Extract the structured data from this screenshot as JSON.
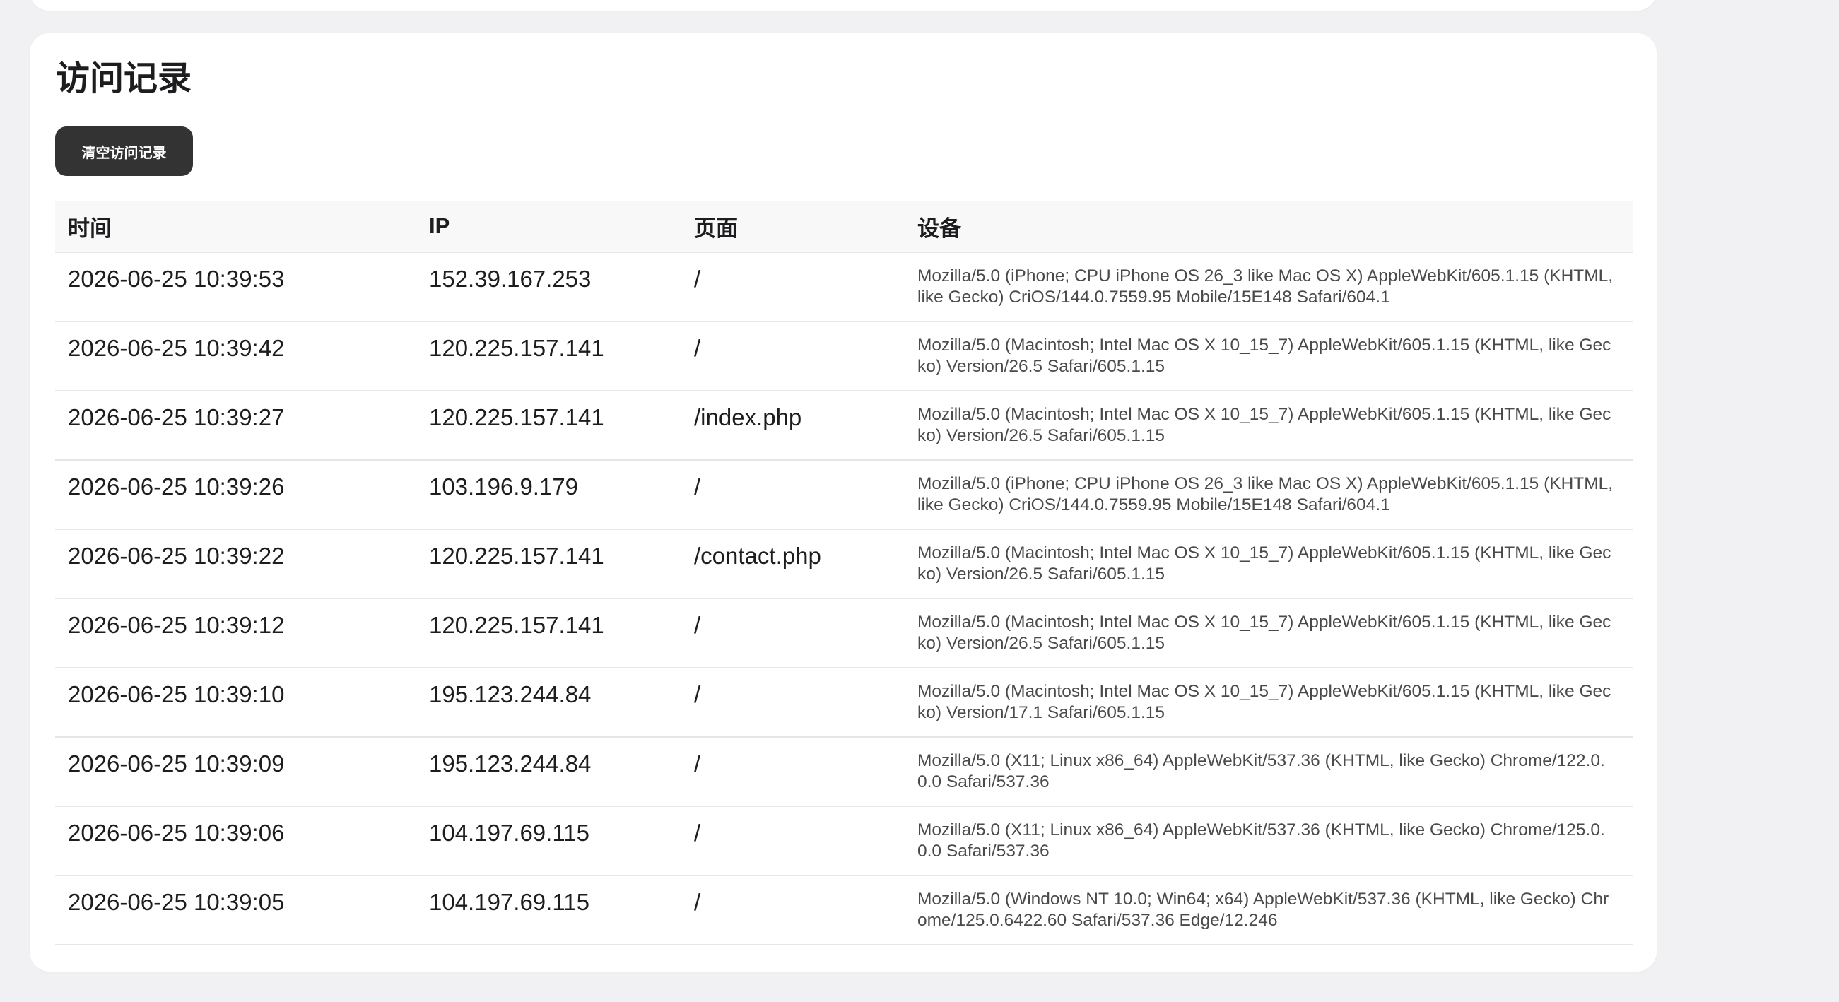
{
  "section": {
    "title": "访问记录",
    "clear_button": "清空访问记录"
  },
  "table": {
    "headers": {
      "time": "时间",
      "ip": "IP",
      "page": "页面",
      "device": "设备"
    },
    "rows": [
      {
        "time": "2026-06-25 10:39:53",
        "ip": "152.39.167.253",
        "page": "/",
        "device": "Mozilla/5.0 (iPhone; CPU iPhone OS 26_3 like Mac OS X) AppleWebKit/605.1.15 (KHTML, like Gecko) CriOS/144.0.7559.95 Mobile/15E148 Safari/604.1"
      },
      {
        "time": "2026-06-25 10:39:42",
        "ip": "120.225.157.141",
        "page": "/",
        "device": "Mozilla/5.0 (Macintosh; Intel Mac OS X 10_15_7) AppleWebKit/605.1.15 (KHTML, like Gecko) Version/26.5 Safari/605.1.15"
      },
      {
        "time": "2026-06-25 10:39:27",
        "ip": "120.225.157.141",
        "page": "/index.php",
        "device": "Mozilla/5.0 (Macintosh; Intel Mac OS X 10_15_7) AppleWebKit/605.1.15 (KHTML, like Gecko) Version/26.5 Safari/605.1.15"
      },
      {
        "time": "2026-06-25 10:39:26",
        "ip": "103.196.9.179",
        "page": "/",
        "device": "Mozilla/5.0 (iPhone; CPU iPhone OS 26_3 like Mac OS X) AppleWebKit/605.1.15 (KHTML, like Gecko) CriOS/144.0.7559.95 Mobile/15E148 Safari/604.1"
      },
      {
        "time": "2026-06-25 10:39:22",
        "ip": "120.225.157.141",
        "page": "/contact.php",
        "device": "Mozilla/5.0 (Macintosh; Intel Mac OS X 10_15_7) AppleWebKit/605.1.15 (KHTML, like Gecko) Version/26.5 Safari/605.1.15"
      },
      {
        "time": "2026-06-25 10:39:12",
        "ip": "120.225.157.141",
        "page": "/",
        "device": "Mozilla/5.0 (Macintosh; Intel Mac OS X 10_15_7) AppleWebKit/605.1.15 (KHTML, like Gecko) Version/26.5 Safari/605.1.15"
      },
      {
        "time": "2026-06-25 10:39:10",
        "ip": "195.123.244.84",
        "page": "/",
        "device": "Mozilla/5.0 (Macintosh; Intel Mac OS X 10_15_7) AppleWebKit/605.1.15 (KHTML, like Gecko) Version/17.1 Safari/605.1.15"
      },
      {
        "time": "2026-06-25 10:39:09",
        "ip": "195.123.244.84",
        "page": "/",
        "device": "Mozilla/5.0 (X11; Linux x86_64) AppleWebKit/537.36 (KHTML, like Gecko) Chrome/122.0.0.0 Safari/537.36"
      },
      {
        "time": "2026-06-25 10:39:06",
        "ip": "104.197.69.115",
        "page": "/",
        "device": "Mozilla/5.0 (X11; Linux x86_64) AppleWebKit/537.36 (KHTML, like Gecko) Chrome/125.0.0.0 Safari/537.36"
      },
      {
        "time": "2026-06-25 10:39:05",
        "ip": "104.197.69.115",
        "page": "/",
        "device": "Mozilla/5.0 (Windows NT 10.0; Win64; x64) AppleWebKit/537.36 (KHTML, like Gecko) Chrome/125.0.6422.60 Safari/537.36 Edge/12.246"
      }
    ]
  },
  "colors": {
    "page_background": "#f1f1f3",
    "card_background": "#ffffff",
    "button_background": "#333333",
    "button_text": "#ffffff",
    "header_row_background": "#f8f8f8",
    "row_divider": "#e6e6e6"
  }
}
